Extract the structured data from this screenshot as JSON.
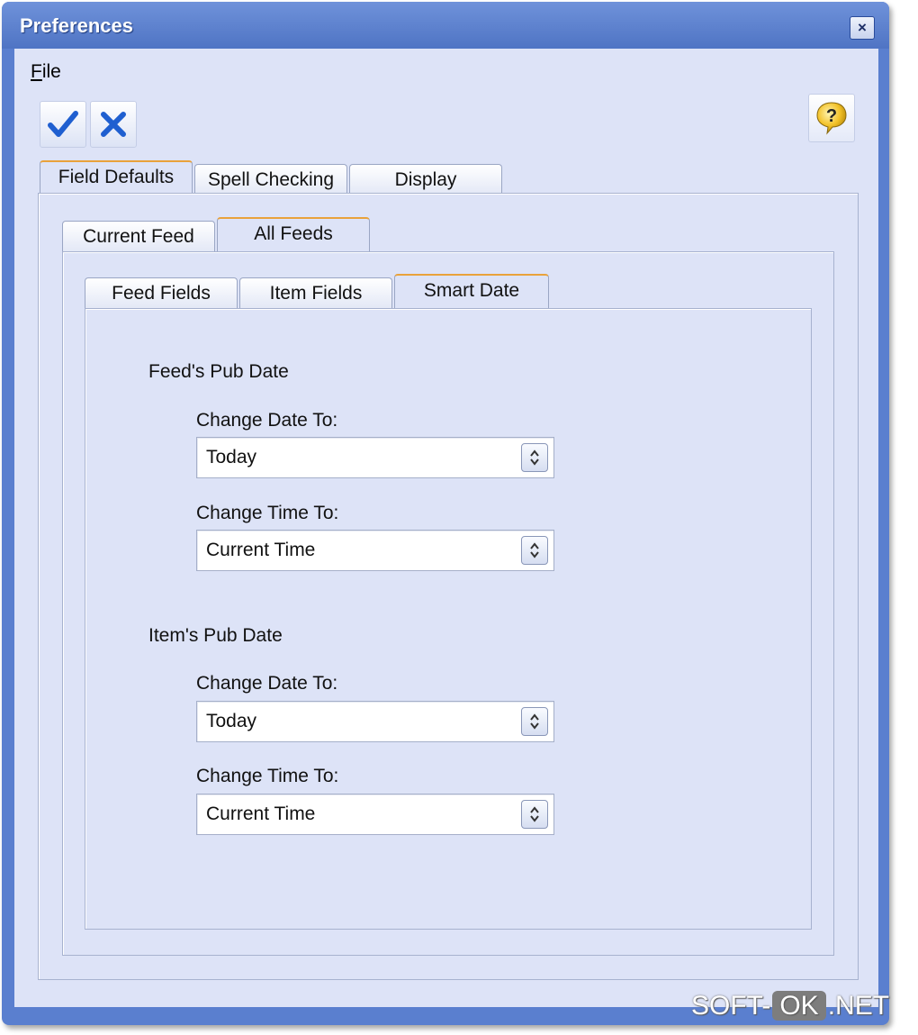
{
  "window": {
    "title": "Preferences",
    "close_glyph": "×"
  },
  "menu": {
    "file_first": "F",
    "file_rest": "ile"
  },
  "toolbar": {
    "ok_icon": "checkmark-icon",
    "cancel_icon": "x-icon",
    "help_icon": "question-icon"
  },
  "tabs_top": [
    "Field Defaults",
    "Spell Checking",
    "Display"
  ],
  "tabs_scope": [
    "Current Feed",
    "All Feeds"
  ],
  "tabs_fields": [
    "Feed Fields",
    "Item Fields",
    "Smart Date"
  ],
  "feed_group": {
    "title": "Feed's Pub Date",
    "date_label": "Change Date To:",
    "date_value": "Today",
    "time_label": "Change Time To:",
    "time_value": "Current Time"
  },
  "item_group": {
    "title": "Item's Pub Date",
    "date_label": "Change Date To:",
    "date_value": "Today",
    "time_label": "Change Time To:",
    "time_value": "Current Time"
  },
  "watermark": {
    "left": "SOFT-",
    "middle": "OK",
    "right": ".NET"
  },
  "colors": {
    "titlebar": "#5a7fcf",
    "client_bg": "#dde3f7",
    "active_tab_accent": "#e9a23b",
    "icon_blue": "#1f5fd0"
  }
}
